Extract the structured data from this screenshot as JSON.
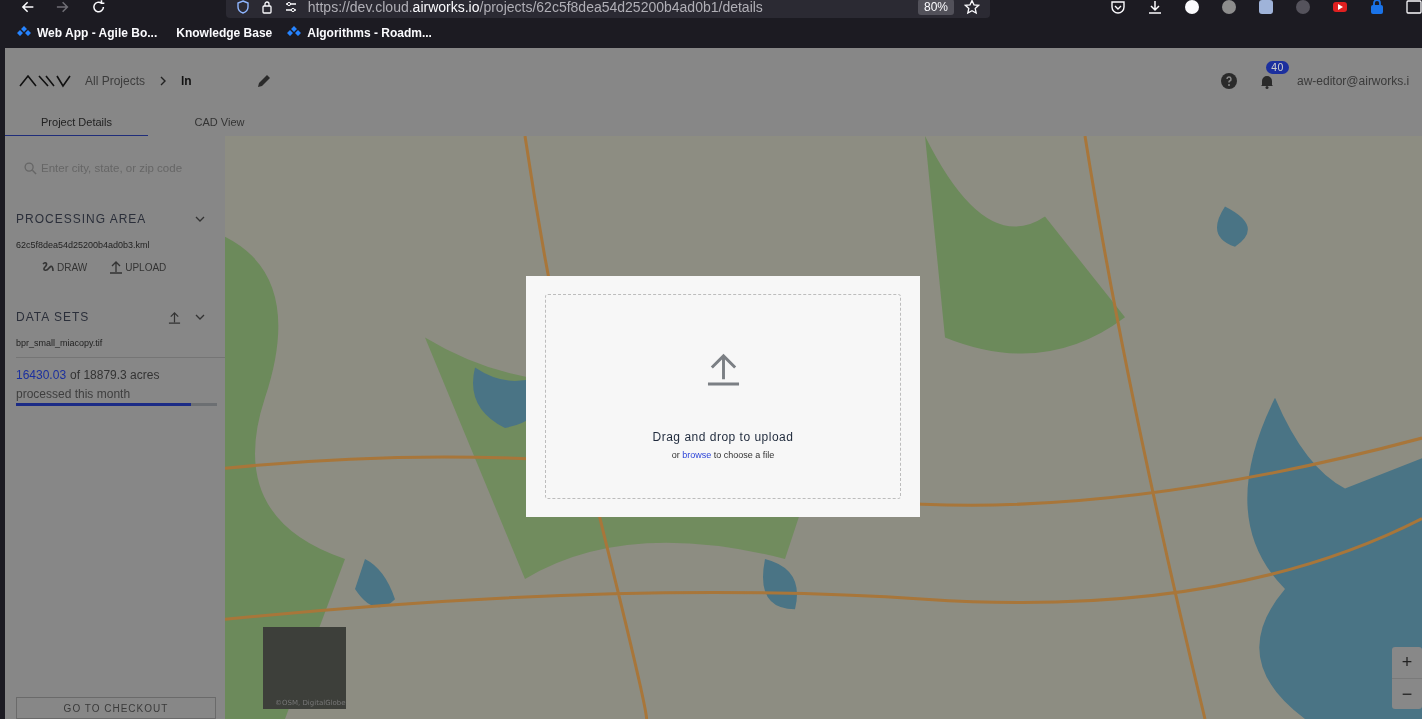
{
  "browser": {
    "url": "https://dev.cloud.**airworks.io**/projects/62c5f8dea54d25200b4ad0b1/details",
    "zoom": "80%",
    "bookmarks": [
      {
        "label": "Web App - Agile Bo...",
        "kind": "icon"
      },
      {
        "label": "Knowledge Base",
        "kind": "plain"
      },
      {
        "label": "Algorithms - Roadm...",
        "kind": "icon"
      }
    ]
  },
  "header": {
    "breadcrumb_root": "All Projects",
    "breadcrumb_current": "ln",
    "notifications_count": "40",
    "user": "aw-editor@airworks.i",
    "tabs": [
      {
        "label": "Project Details",
        "selected": true
      },
      {
        "label": "CAD View",
        "selected": false
      }
    ]
  },
  "sidebar": {
    "search": {
      "placeholder": "Enter city, state, or zip code"
    },
    "processing_area": {
      "title": "PROCESSING AREA",
      "filename": "62c5f8dea54d25200b4ad0b3.kml",
      "actions": [
        {
          "label": "DRAW",
          "kind": "draw"
        },
        {
          "label": "UPLOAD",
          "kind": "upload"
        }
      ]
    },
    "data_sets": {
      "title": "DATA SETS",
      "filename": "bpr_small_miacopy.tif"
    },
    "usage": {
      "used": "16430.03",
      "total": "of 18879.3 acres",
      "caption": "processed this month",
      "level": 0.87
    },
    "checkout_button": "GO TO CHECKOUT"
  },
  "map": {
    "attribution": "©OSM, DigitalGlobe",
    "zoom_in": "+",
    "zoom_out": "−"
  },
  "upload_dialog": {
    "title": "Drag and drop to upload",
    "hint_prefix": "or",
    "link": "browse",
    "hint_suffix": "to choose a file"
  }
}
